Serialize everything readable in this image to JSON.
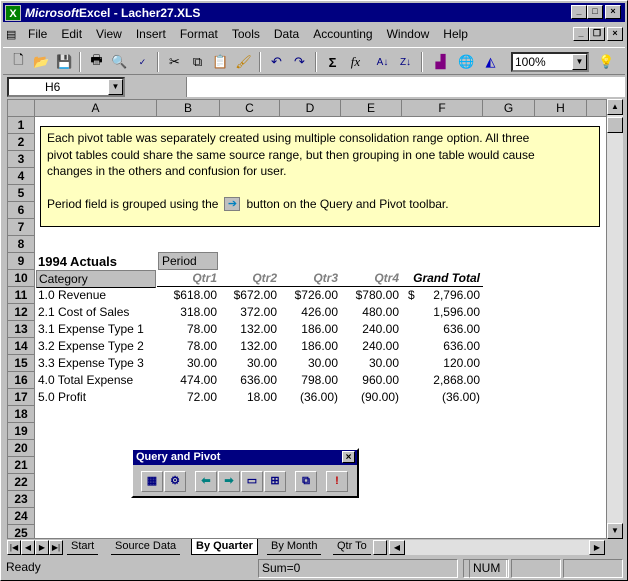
{
  "window": {
    "title_app": "Microsoft",
    "title_rest": " Excel - Lacher27.XLS"
  },
  "menu": [
    "File",
    "Edit",
    "View",
    "Insert",
    "Format",
    "Tools",
    "Data",
    "Accounting",
    "Window",
    "Help"
  ],
  "toolbar": {
    "zoom": "100%"
  },
  "formula": {
    "name_box": "H6",
    "content": ""
  },
  "columns": [
    "A",
    "B",
    "C",
    "D",
    "E",
    "F",
    "G",
    "H"
  ],
  "rows": [
    "1",
    "2",
    "3",
    "4",
    "5",
    "6",
    "7",
    "8",
    "9",
    "10",
    "11",
    "12",
    "13",
    "14",
    "15",
    "16",
    "17",
    "18",
    "19",
    "20",
    "21",
    "22",
    "23",
    "24",
    "25"
  ],
  "note": {
    "line1": "Each pivot table was separately created using multiple consolidation range option.  All three",
    "line2": "pivot tables could share the same source range, but then grouping in one table would cause",
    "line3": "changes in the others and confusion for user.",
    "line4a": "Period field is grouped using the",
    "line4b": "button  on the Query and Pivot toolbar."
  },
  "pivot": {
    "title": "1994 Actuals",
    "period_label": "Period",
    "category_label": "Category",
    "headers": [
      "Qtr1",
      "Qtr2",
      "Qtr3",
      "Qtr4",
      "Grand Total"
    ],
    "rows": [
      {
        "cat": "1.0 Revenue",
        "v": [
          "$618.00",
          "$672.00",
          "$726.00",
          "$780.00"
        ],
        "cur": "$",
        "total": "2,796.00"
      },
      {
        "cat": "2.1 Cost of Sales",
        "v": [
          "318.00",
          "372.00",
          "426.00",
          "480.00"
        ],
        "cur": "",
        "total": "1,596.00"
      },
      {
        "cat": "3.1 Expense Type 1",
        "v": [
          "78.00",
          "132.00",
          "186.00",
          "240.00"
        ],
        "cur": "",
        "total": "636.00"
      },
      {
        "cat": "3.2 Expense Type 2",
        "v": [
          "78.00",
          "132.00",
          "186.00",
          "240.00"
        ],
        "cur": "",
        "total": "636.00"
      },
      {
        "cat": "3.3 Expense Type 3",
        "v": [
          "30.00",
          "30.00",
          "30.00",
          "30.00"
        ],
        "cur": "",
        "total": "120.00"
      },
      {
        "cat": "4.0 Total Expense",
        "v": [
          "474.00",
          "636.00",
          "798.00",
          "960.00"
        ],
        "cur": "",
        "total": "2,868.00"
      },
      {
        "cat": "5.0 Profit",
        "v": [
          "72.00",
          "18.00",
          "(36.00)",
          "(90.00)"
        ],
        "cur": "",
        "total": "(36.00)"
      }
    ]
  },
  "query_pivot": {
    "title": "Query and Pivot"
  },
  "tabs": [
    "Start",
    "Source Data",
    "By Quarter",
    "By Month",
    "Qtr To"
  ],
  "status": {
    "ready": "Ready",
    "sum": "Sum=0",
    "num": "NUM"
  }
}
